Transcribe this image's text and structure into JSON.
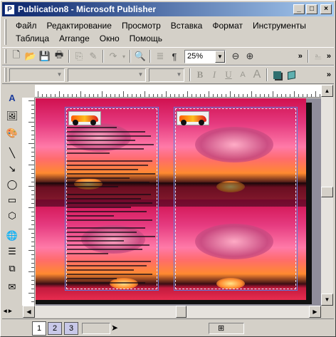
{
  "window": {
    "title": "Publication8 - Microsoft Publisher",
    "app_icon": "publisher-icon",
    "controls": [
      "minimize-icon",
      "maximize-icon",
      "close-icon"
    ]
  },
  "menu": {
    "row1": [
      "Файл",
      "Редактирование",
      "Просмотр",
      "Вставка",
      "Формат",
      "Инструменты"
    ],
    "row2": [
      "Таблица",
      "Arrange",
      "Окно",
      "Помощь"
    ]
  },
  "toolbar": {
    "zoom_value": "25%",
    "icons": [
      "new-icon",
      "open-icon",
      "save-icon",
      "print-preview-icon",
      "copy-icon",
      "format-painter-icon",
      "redo-icon",
      "zoom-page-icon",
      "columns-icon",
      "paragraph-icon",
      "zoom-out-icon",
      "zoom-in-icon",
      "chevron-icon"
    ]
  },
  "format_toolbar": {
    "bold": "B",
    "italic": "I",
    "underline": "U",
    "font_grow": "A",
    "font_shrink": "A"
  },
  "objects_toolbar": {
    "tools": [
      "pointer-text-icon",
      "picture-icon",
      "clipart-icon",
      "line-icon",
      "arrow-icon",
      "oval-icon",
      "rectangle-icon",
      "autoshapes-icon",
      "web-icon",
      "form-control-icon",
      "insert-object-icon",
      "design-gallery-icon"
    ]
  },
  "pages": {
    "tabs": [
      "1",
      "2",
      "3"
    ],
    "active": "1"
  },
  "colors": {
    "titlebar_start": "#0a246a",
    "titlebar_end": "#a6caf0",
    "chrome": "#d4d0c8",
    "workspace": "#8f8d9a"
  }
}
